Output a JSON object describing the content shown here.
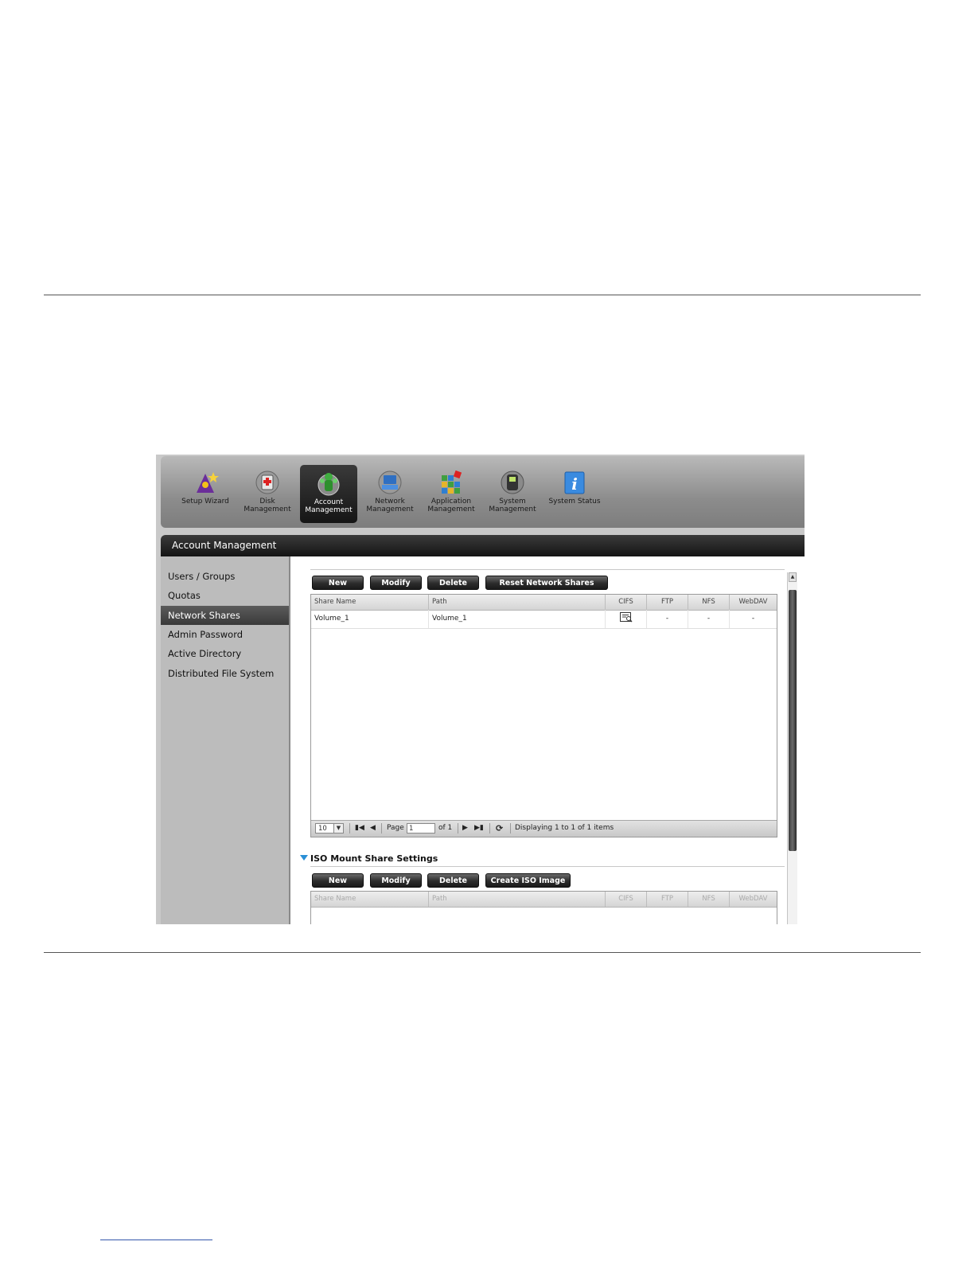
{
  "toolbar": {
    "items": [
      {
        "label": "Setup Wizard",
        "icon": "wizard-icon"
      },
      {
        "label": "Disk Management",
        "icon": "disk-management-icon"
      },
      {
        "label": "Account Management",
        "icon": "account-management-icon"
      },
      {
        "label": "Network Management",
        "icon": "network-management-icon"
      },
      {
        "label": "Application Management",
        "icon": "application-management-icon"
      },
      {
        "label": "System Management",
        "icon": "system-management-icon"
      },
      {
        "label": "System Status",
        "icon": "system-status-icon"
      }
    ],
    "active": "Account Management"
  },
  "title_bar": "Account Management",
  "sidebar": {
    "items": [
      {
        "label": "Users / Groups"
      },
      {
        "label": "Quotas"
      },
      {
        "label": "Network Shares"
      },
      {
        "label": "Admin Password"
      },
      {
        "label": "Active Directory"
      },
      {
        "label": "Distributed File System"
      }
    ],
    "active": "Network Shares"
  },
  "network_shares": {
    "buttons": {
      "new": "New",
      "modify": "Modify",
      "delete": "Delete",
      "reset": "Reset Network Shares"
    },
    "columns": [
      "Share Name",
      "Path",
      "CIFS",
      "FTP",
      "NFS",
      "WebDAV"
    ],
    "rows": [
      {
        "share_name": "Volume_1",
        "path": "Volume_1",
        "cifs": "document-icon",
        "ftp": "-",
        "nfs": "-",
        "webdav": "-"
      }
    ],
    "pager": {
      "page_size": "10",
      "page_label": "Page",
      "page_value": "1",
      "of_label": "of 1",
      "status": "Displaying 1 to 1 of 1 items"
    }
  },
  "iso_mount": {
    "title": "ISO Mount Share Settings",
    "buttons": {
      "new": "New",
      "modify": "Modify",
      "delete": "Delete",
      "create": "Create ISO Image"
    },
    "columns": [
      "Share Name",
      "Path",
      "CIFS",
      "FTP",
      "NFS",
      "WebDAV"
    ]
  },
  "colors": {
    "accent": "#2a8fd6",
    "active_tab": "#151515",
    "sidebar_active": "#4a4a4a"
  }
}
